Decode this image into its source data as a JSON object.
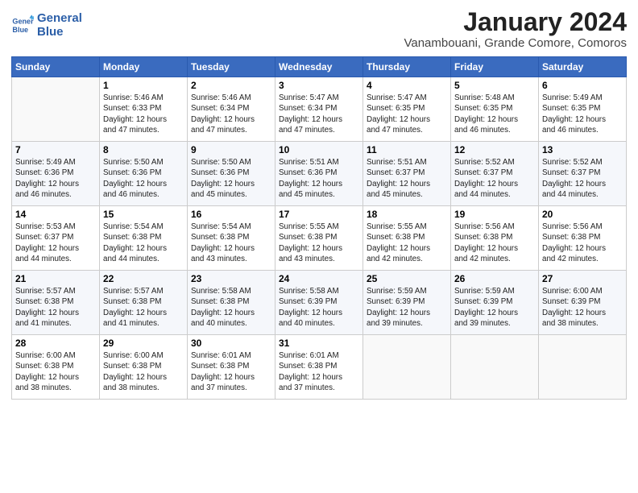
{
  "header": {
    "logo_line1": "General",
    "logo_line2": "Blue",
    "title": "January 2024",
    "subtitle": "Vanambouani, Grande Comore, Comoros"
  },
  "days_of_week": [
    "Sunday",
    "Monday",
    "Tuesday",
    "Wednesday",
    "Thursday",
    "Friday",
    "Saturday"
  ],
  "weeks": [
    [
      {
        "day": "",
        "info": ""
      },
      {
        "day": "1",
        "info": "Sunrise: 5:46 AM\nSunset: 6:33 PM\nDaylight: 12 hours\nand 47 minutes."
      },
      {
        "day": "2",
        "info": "Sunrise: 5:46 AM\nSunset: 6:34 PM\nDaylight: 12 hours\nand 47 minutes."
      },
      {
        "day": "3",
        "info": "Sunrise: 5:47 AM\nSunset: 6:34 PM\nDaylight: 12 hours\nand 47 minutes."
      },
      {
        "day": "4",
        "info": "Sunrise: 5:47 AM\nSunset: 6:35 PM\nDaylight: 12 hours\nand 47 minutes."
      },
      {
        "day": "5",
        "info": "Sunrise: 5:48 AM\nSunset: 6:35 PM\nDaylight: 12 hours\nand 46 minutes."
      },
      {
        "day": "6",
        "info": "Sunrise: 5:49 AM\nSunset: 6:35 PM\nDaylight: 12 hours\nand 46 minutes."
      }
    ],
    [
      {
        "day": "7",
        "info": "Sunrise: 5:49 AM\nSunset: 6:36 PM\nDaylight: 12 hours\nand 46 minutes."
      },
      {
        "day": "8",
        "info": "Sunrise: 5:50 AM\nSunset: 6:36 PM\nDaylight: 12 hours\nand 46 minutes."
      },
      {
        "day": "9",
        "info": "Sunrise: 5:50 AM\nSunset: 6:36 PM\nDaylight: 12 hours\nand 45 minutes."
      },
      {
        "day": "10",
        "info": "Sunrise: 5:51 AM\nSunset: 6:36 PM\nDaylight: 12 hours\nand 45 minutes."
      },
      {
        "day": "11",
        "info": "Sunrise: 5:51 AM\nSunset: 6:37 PM\nDaylight: 12 hours\nand 45 minutes."
      },
      {
        "day": "12",
        "info": "Sunrise: 5:52 AM\nSunset: 6:37 PM\nDaylight: 12 hours\nand 44 minutes."
      },
      {
        "day": "13",
        "info": "Sunrise: 5:52 AM\nSunset: 6:37 PM\nDaylight: 12 hours\nand 44 minutes."
      }
    ],
    [
      {
        "day": "14",
        "info": "Sunrise: 5:53 AM\nSunset: 6:37 PM\nDaylight: 12 hours\nand 44 minutes."
      },
      {
        "day": "15",
        "info": "Sunrise: 5:54 AM\nSunset: 6:38 PM\nDaylight: 12 hours\nand 44 minutes."
      },
      {
        "day": "16",
        "info": "Sunrise: 5:54 AM\nSunset: 6:38 PM\nDaylight: 12 hours\nand 43 minutes."
      },
      {
        "day": "17",
        "info": "Sunrise: 5:55 AM\nSunset: 6:38 PM\nDaylight: 12 hours\nand 43 minutes."
      },
      {
        "day": "18",
        "info": "Sunrise: 5:55 AM\nSunset: 6:38 PM\nDaylight: 12 hours\nand 42 minutes."
      },
      {
        "day": "19",
        "info": "Sunrise: 5:56 AM\nSunset: 6:38 PM\nDaylight: 12 hours\nand 42 minutes."
      },
      {
        "day": "20",
        "info": "Sunrise: 5:56 AM\nSunset: 6:38 PM\nDaylight: 12 hours\nand 42 minutes."
      }
    ],
    [
      {
        "day": "21",
        "info": "Sunrise: 5:57 AM\nSunset: 6:38 PM\nDaylight: 12 hours\nand 41 minutes."
      },
      {
        "day": "22",
        "info": "Sunrise: 5:57 AM\nSunset: 6:38 PM\nDaylight: 12 hours\nand 41 minutes."
      },
      {
        "day": "23",
        "info": "Sunrise: 5:58 AM\nSunset: 6:38 PM\nDaylight: 12 hours\nand 40 minutes."
      },
      {
        "day": "24",
        "info": "Sunrise: 5:58 AM\nSunset: 6:39 PM\nDaylight: 12 hours\nand 40 minutes."
      },
      {
        "day": "25",
        "info": "Sunrise: 5:59 AM\nSunset: 6:39 PM\nDaylight: 12 hours\nand 39 minutes."
      },
      {
        "day": "26",
        "info": "Sunrise: 5:59 AM\nSunset: 6:39 PM\nDaylight: 12 hours\nand 39 minutes."
      },
      {
        "day": "27",
        "info": "Sunrise: 6:00 AM\nSunset: 6:39 PM\nDaylight: 12 hours\nand 38 minutes."
      }
    ],
    [
      {
        "day": "28",
        "info": "Sunrise: 6:00 AM\nSunset: 6:38 PM\nDaylight: 12 hours\nand 38 minutes."
      },
      {
        "day": "29",
        "info": "Sunrise: 6:00 AM\nSunset: 6:38 PM\nDaylight: 12 hours\nand 38 minutes."
      },
      {
        "day": "30",
        "info": "Sunrise: 6:01 AM\nSunset: 6:38 PM\nDaylight: 12 hours\nand 37 minutes."
      },
      {
        "day": "31",
        "info": "Sunrise: 6:01 AM\nSunset: 6:38 PM\nDaylight: 12 hours\nand 37 minutes."
      },
      {
        "day": "",
        "info": ""
      },
      {
        "day": "",
        "info": ""
      },
      {
        "day": "",
        "info": ""
      }
    ]
  ]
}
